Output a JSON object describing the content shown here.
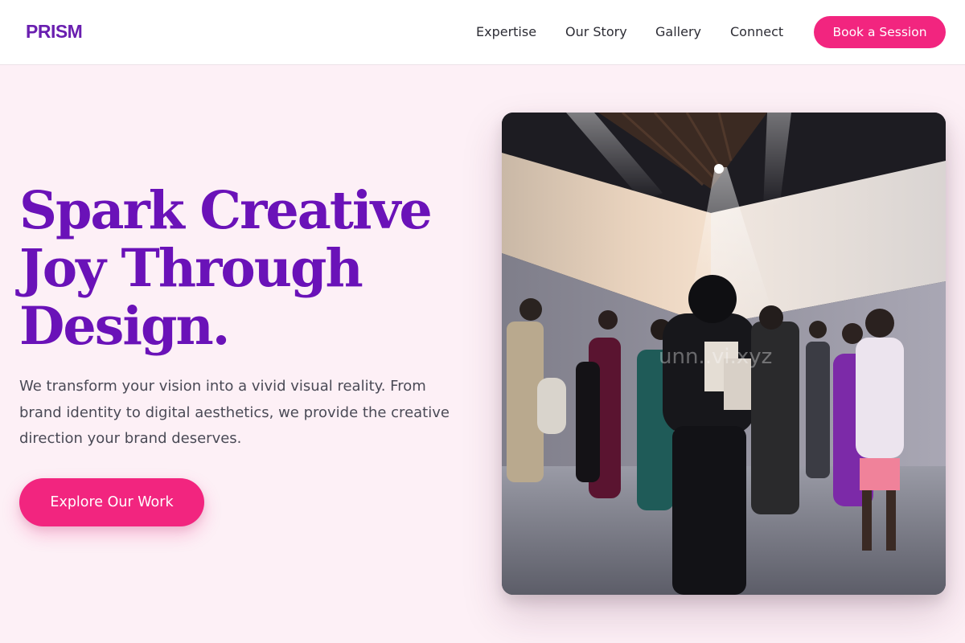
{
  "brand": {
    "logo": "PRISM"
  },
  "nav": {
    "links": [
      "Expertise",
      "Our Story",
      "Gallery",
      "Connect"
    ],
    "cta_label": "Book a Session"
  },
  "hero": {
    "title_lines": [
      "Spark Creative",
      "Joy Through",
      "Design."
    ],
    "subtitle": "We transform your vision into a vivid visual reality. From brand identity to digital aesthetics, we provide the creative direction your brand deserves.",
    "cta_label": "Explore Our Work",
    "image_watermark": "unn..vi.xyz"
  },
  "colors": {
    "brand_purple": "#6a12b8",
    "accent_pink": "#f2257f",
    "background": "#fdf0f6"
  }
}
